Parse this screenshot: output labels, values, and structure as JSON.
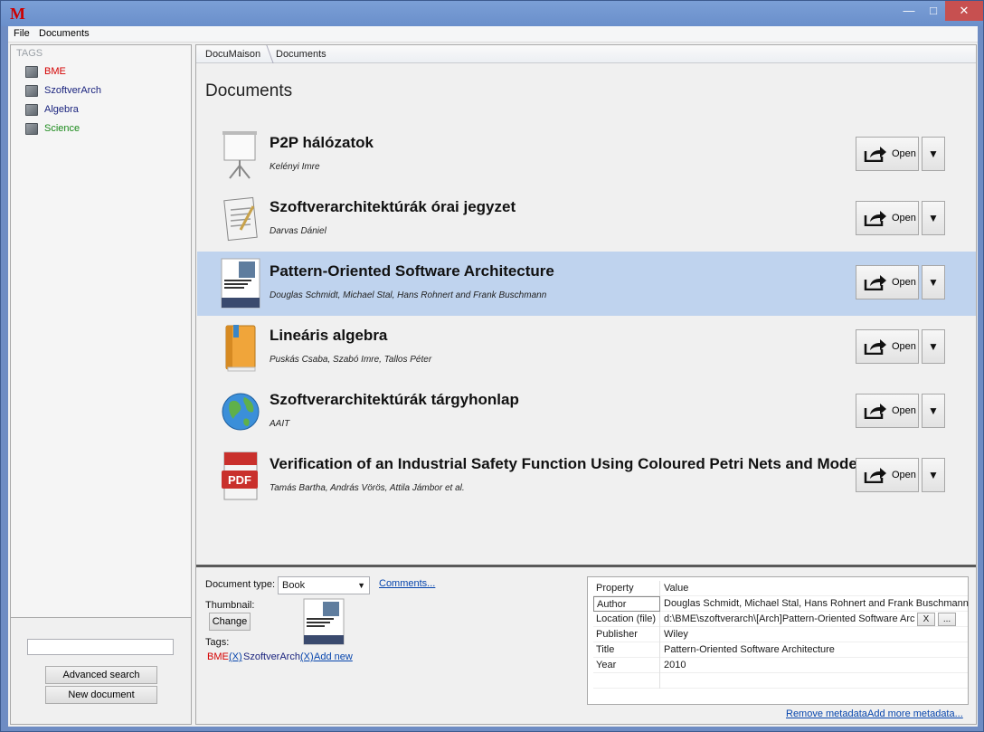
{
  "window": {
    "logo": "M",
    "controls": {
      "minimize": "—",
      "maximize": "□",
      "close": "✕"
    }
  },
  "menu": [
    "File",
    "Documents"
  ],
  "sidebar": {
    "header": "TAGS",
    "tags": [
      {
        "label": "BME",
        "color": "#d40000"
      },
      {
        "label": "SzoftverArch",
        "color": "#1a237e"
      },
      {
        "label": "Algebra",
        "color": "#1a237e"
      },
      {
        "label": "Science",
        "color": "#1b8a1b"
      }
    ],
    "search_value": "",
    "advanced_search_label": "Advanced search",
    "new_document_label": "New document"
  },
  "breadcrumb": [
    "DocuMaison",
    "Documents"
  ],
  "page_title": "Documents",
  "documents": [
    {
      "title": "P2P hálózatok",
      "author": "Kelényi Imre",
      "icon": "presentation-icon",
      "selected": false
    },
    {
      "title": "Szoftverarchitektúrák órai jegyzet",
      "author": "Darvas Dániel",
      "icon": "notepad-icon",
      "selected": false
    },
    {
      "title": "Pattern-Oriented Software Architecture",
      "author": "Douglas Schmidt, Michael Stal, Hans Rohnert and Frank Buschmann",
      "icon": "book-cover-icon",
      "selected": true
    },
    {
      "title": "Lineáris algebra",
      "author": "Puskás Csaba, Szabó Imre, Tallos Péter",
      "icon": "book-icon",
      "selected": false
    },
    {
      "title": "Szoftverarchitektúrák tárgyhonlap",
      "author": "AAIT",
      "icon": "globe-icon",
      "selected": false
    },
    {
      "title": "Verification of an Industrial Safety Function Using Coloured Petri Nets and Mode",
      "author": "Tamás Bartha, András Vörös, Attila Jámbor et al.",
      "icon": "pdf-icon",
      "selected": false
    }
  ],
  "open_label": "Open",
  "more_symbol": "▼",
  "details": {
    "document_type_label": "Document type:",
    "document_type_value": "Book",
    "comments_link": "Comments...",
    "thumbnail_label": "Thumbnail:",
    "change_label": "Change",
    "tags_label": "Tags:",
    "tags": [
      {
        "label": "BME",
        "color": "#d40000",
        "remove": "(X)"
      },
      {
        "label": "SzoftverArch",
        "color": "#1a237e",
        "remove": "(X)"
      }
    ],
    "add_new_link": "Add new",
    "grid_header": {
      "property": "Property",
      "value": "Value"
    },
    "properties": [
      {
        "name": "Author",
        "value": "Douglas Schmidt, Michael Stal, Hans Rohnert and Frank Buschmann"
      },
      {
        "name": "Location (file)",
        "value": "d:\\BME\\szoftverarch\\[Arch]Pattern-Oriented Software Arch",
        "clear": "X",
        "browse": "..."
      },
      {
        "name": "Publisher",
        "value": "Wiley"
      },
      {
        "name": "Title",
        "value": "Pattern-Oriented Software Architecture"
      },
      {
        "name": "Year",
        "value": "2010"
      }
    ],
    "remove_metadata_link": "Remove metadata",
    "add_metadata_link": "Add more metadata..."
  },
  "colors": {
    "selection": "#bfd3ee",
    "link": "#0645ad",
    "titlebar": "#6e8cc3"
  }
}
